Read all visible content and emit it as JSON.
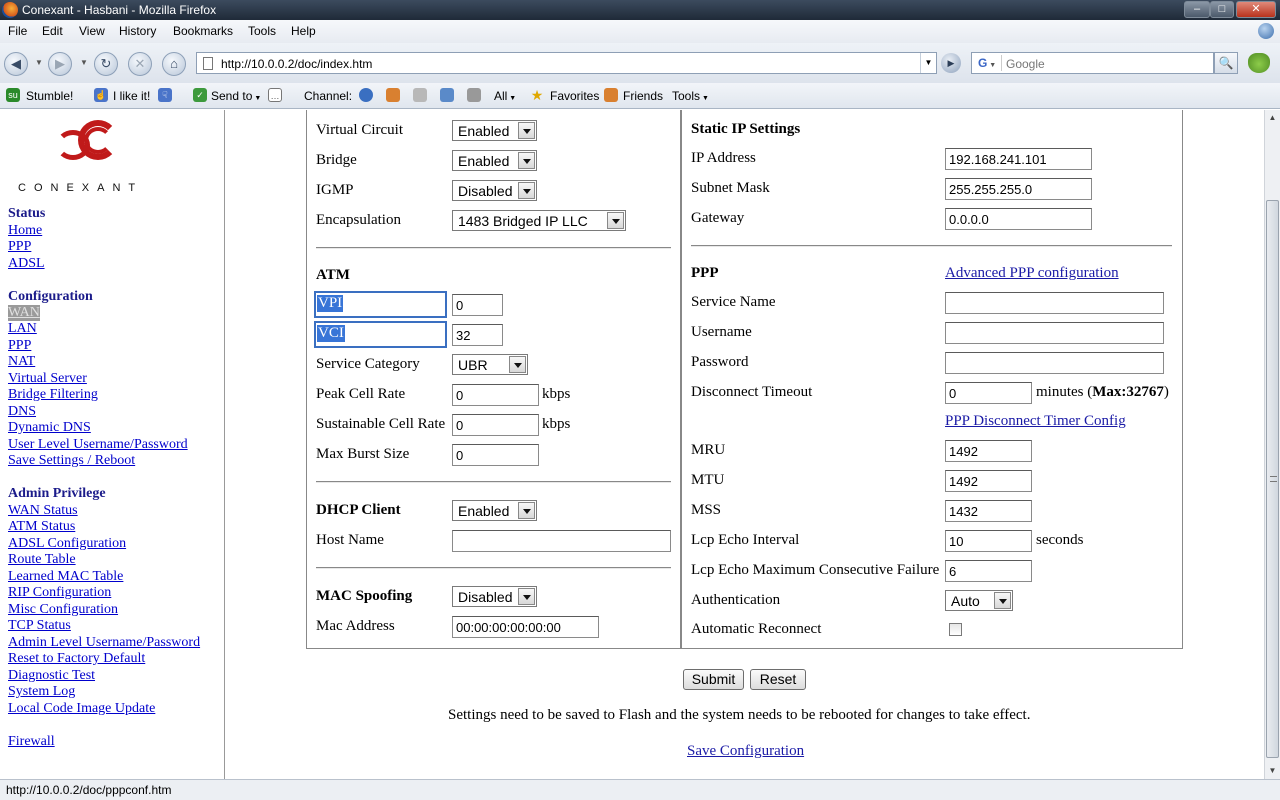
{
  "window": {
    "title": "Conexant - Hasbani - Mozilla Firefox"
  },
  "menu": [
    "File",
    "Edit",
    "View",
    "History",
    "Bookmarks",
    "Tools",
    "Help"
  ],
  "nav": {
    "url": "http://10.0.0.2/doc/index.htm",
    "search_engine": "G",
    "search_placeholder": "Google"
  },
  "stumble": {
    "stumble": "Stumble!",
    "like": "I like it!",
    "send_to": "Send to",
    "channel": "Channel:",
    "all": "All",
    "favorites": "Favorites",
    "friends": "Friends",
    "tools": "Tools"
  },
  "sidebar": {
    "logo_text": "CONEXANT",
    "status_head": "Status",
    "status_links": [
      "Home",
      "PPP",
      "ADSL"
    ],
    "config_head": "Configuration",
    "config_links": [
      "WAN",
      "LAN",
      "PPP",
      "NAT",
      "Virtual Server",
      "Bridge Filtering",
      "DNS",
      "Dynamic DNS",
      "User Level Username/Password",
      "Save Settings / Reboot"
    ],
    "admin_head": "Admin Privilege",
    "admin_links": [
      "WAN Status",
      "ATM Status",
      "ADSL Configuration",
      "Route Table",
      "Learned MAC Table",
      "RIP Configuration",
      "Misc Configuration",
      "TCP Status",
      "Admin Level Username/Password",
      "Reset to Factory Default",
      "Diagnostic Test",
      "System Log",
      "Local Code Image Update"
    ],
    "firewall": "Firewall"
  },
  "left": {
    "virtual_circuit": {
      "label": "Virtual Circuit",
      "value": "Enabled"
    },
    "bridge": {
      "label": "Bridge",
      "value": "Enabled"
    },
    "igmp": {
      "label": "IGMP",
      "value": "Disabled"
    },
    "encapsulation": {
      "label": "Encapsulation",
      "value": "1483 Bridged IP LLC"
    },
    "atm_head": "ATM",
    "vpi": {
      "label": "VPI",
      "value": "0"
    },
    "vci": {
      "label": "VCI",
      "value": "32"
    },
    "service_category": {
      "label": "Service Category",
      "value": "UBR"
    },
    "peak_cell_rate": {
      "label": "Peak Cell Rate",
      "value": "0",
      "unit": "kbps"
    },
    "sustainable_cell_rate": {
      "label": "Sustainable Cell Rate",
      "value": "0",
      "unit": "kbps"
    },
    "max_burst_size": {
      "label": "Max Burst Size",
      "value": "0"
    },
    "dhcp_client": {
      "label": "DHCP Client",
      "value": "Enabled"
    },
    "host_name": {
      "label": "Host Name",
      "value": ""
    },
    "mac_spoofing": {
      "label": "MAC Spoofing",
      "value": "Disabled"
    },
    "mac_address": {
      "label": "Mac Address",
      "value": "00:00:00:00:00:00"
    }
  },
  "right": {
    "static_head": "Static IP Settings",
    "ip_address": {
      "label": "IP Address",
      "value": "192.168.241.101"
    },
    "subnet_mask": {
      "label": "Subnet Mask",
      "value": "255.255.255.0"
    },
    "gateway": {
      "label": "Gateway",
      "value": "0.0.0.0"
    },
    "ppp_head": "PPP",
    "advanced_ppp": "Advanced PPP configuration",
    "service_name": {
      "label": "Service Name",
      "value": ""
    },
    "username": {
      "label": "Username",
      "value": ""
    },
    "password": {
      "label": "Password",
      "value": ""
    },
    "disconnect_timeout": {
      "label": "Disconnect Timeout",
      "value": "0",
      "unit": "minutes (",
      "max": "Max:32767",
      "close": ")"
    },
    "timer_link": "PPP Disconnect Timer Config",
    "mru": {
      "label": "MRU",
      "value": "1492"
    },
    "mtu": {
      "label": "MTU",
      "value": "1492"
    },
    "mss": {
      "label": "MSS",
      "value": "1432"
    },
    "lcp_echo_interval": {
      "label": "Lcp Echo Interval",
      "value": "10",
      "unit": "seconds"
    },
    "lcp_echo_max": {
      "label": "Lcp Echo Maximum Consecutive Failure",
      "value": "6"
    },
    "authentication": {
      "label": "Authentication",
      "value": "Auto"
    },
    "auto_reconnect": {
      "label": "Automatic Reconnect",
      "checked": false
    }
  },
  "footer": {
    "submit": "Submit",
    "reset": "Reset",
    "note": "Settings need to be saved to Flash and the system needs to be rebooted for changes to take effect.",
    "save_link": "Save Configuration"
  },
  "status_bar": "http://10.0.0.2/doc/pppconf.htm"
}
